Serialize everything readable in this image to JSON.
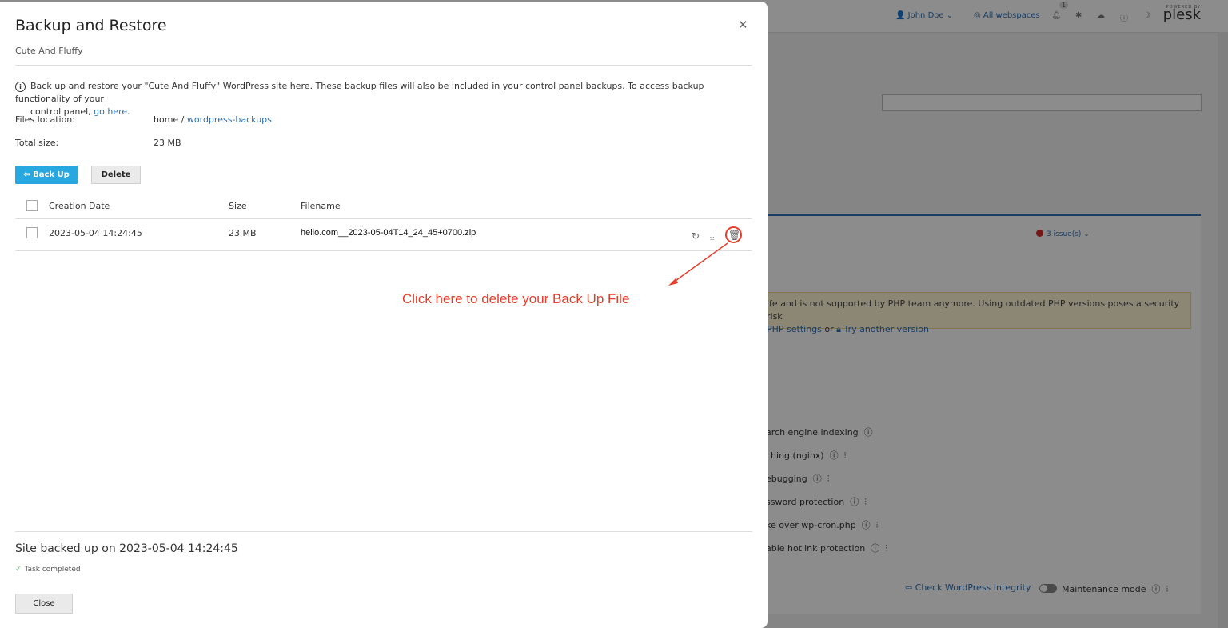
{
  "background": {
    "user": "John Doe",
    "webspaces": "All webspaces",
    "notification_count": "1",
    "logo": {
      "brand": "plesk",
      "tagline": "POWERED BY"
    },
    "issues": "3 issue(s)",
    "warning_line1": "ife and is not supported by PHP team anymore. Using outdated PHP versions poses a security risk",
    "warning_line2": "PHP settings",
    "warning_or": "or",
    "warning_link2": "Try another version",
    "options": [
      "arch engine indexing",
      "ching (nginx)",
      "ebugging",
      "ssword protection",
      "ke over wp-cron.php",
      "able hotlink protection"
    ],
    "check_integrity": "Check WordPress Integrity",
    "maintenance": "Maintenance mode"
  },
  "dialog": {
    "title": "Backup and Restore",
    "subtitle": "Cute And Fluffy",
    "info_text": "Back up and restore your \"Cute And Fluffy\" WordPress site here. These backup files will also be included in your control panel backups. To access backup functionality of your",
    "info_text2": "control panel,",
    "info_link": "go here",
    "info_end": ".",
    "files_location_label": "Files location:",
    "files_location_root": "home /",
    "files_location_link": "wordpress-backups",
    "total_size_label": "Total size:",
    "total_size_value": "23 MB",
    "backup_button": "Back Up",
    "delete_button": "Delete",
    "table": {
      "headers": {
        "date": "Creation Date",
        "size": "Size",
        "filename": "Filename"
      },
      "rows": [
        {
          "date": "2023-05-04 14:24:45",
          "size": "23 MB",
          "filename": "hello.com__2023-05-04T14_24_45+0700.zip"
        }
      ]
    },
    "annotation": "Click here to delete your Back Up File",
    "footer_title": "Site backed up on 2023-05-04 14:24:45",
    "footer_status": "Task completed",
    "close_button": "Close"
  },
  "colors": {
    "accent": "#28a8e0",
    "link": "#2e6fb3",
    "annotation": "#e53e2a"
  }
}
